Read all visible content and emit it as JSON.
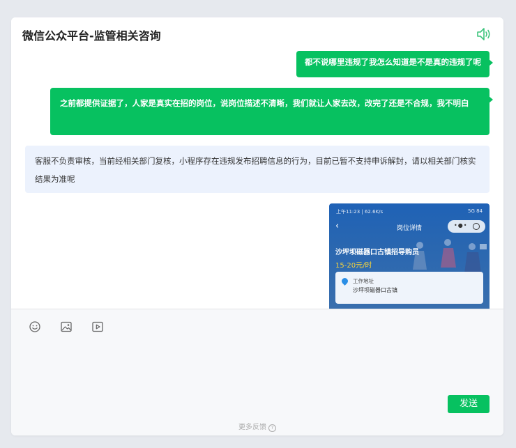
{
  "header": {
    "title": "微信公众平台-监管相关咨询",
    "speaker_icon": "speaker-icon"
  },
  "messages": [
    {
      "direction": "out",
      "text": "都不说哪里违规了我怎么知道是不是真的违规了呢"
    },
    {
      "direction": "out",
      "text": "之前都提供证据了，人家是真实在招的岗位，说岗位描述不清晰，我们就让人家去改，改完了还是不合规，我不明白"
    },
    {
      "direction": "in",
      "text": "客服不负责审核，当前经相关部门复核，小程序存在违规发布招聘信息的行为，目前已暂不支持申诉解封，请以相关部门核实结果为准呢"
    }
  ],
  "screenshot_message": {
    "status_left": "上午11:23 | 62.6K/s",
    "status_right": "5G 84",
    "nav_title": "岗位详情",
    "job_title": "沙坪坝磁器口古镇招导购员",
    "salary": "15-20元/时",
    "address_label": "工作地址",
    "address": "沙坪坝磁器口古镇"
  },
  "composer": {
    "tools": [
      "emoji-icon",
      "image-icon",
      "video-icon"
    ],
    "send_label": "发送",
    "feedback_label": "更多反馈",
    "help_glyph": "?"
  },
  "colors": {
    "accent": "#07c160",
    "incoming_bubble": "#ecf2fd",
    "background": "#e6e9ee"
  }
}
